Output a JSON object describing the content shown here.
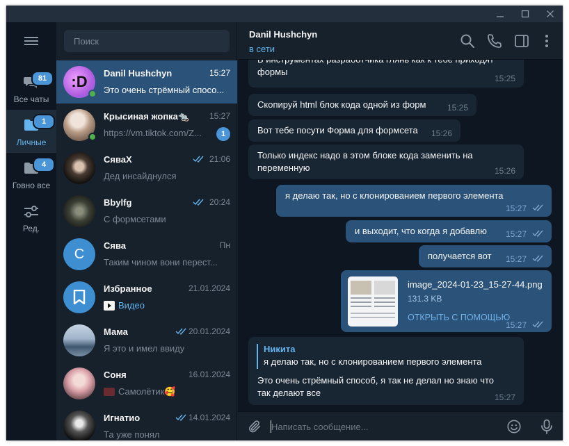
{
  "window": {
    "accent": "#4a94d8",
    "bg_dark": "#0e1621",
    "bg_panel": "#17212b",
    "selected": "#2b5278"
  },
  "folders": [
    {
      "label": "Все чаты",
      "badge": "81",
      "icon": "chat-bubbles-icon"
    },
    {
      "label": "Личные",
      "badge": "1",
      "icon": "folder-icon",
      "active": true
    },
    {
      "label": "Говно все",
      "badge": "4",
      "icon": "folder-icon"
    },
    {
      "label": "Ред.",
      "badge": "",
      "icon": "edit-sliders-icon"
    }
  ],
  "search": {
    "placeholder": "Поиск"
  },
  "chats": [
    {
      "name": "Danil Hushchyn",
      "time": "15:27",
      "preview": "Это очень стрёмный спосо...",
      "avatar": ":D",
      "avatar_color": "#c86ee6",
      "online": true,
      "active": true
    },
    {
      "name": "Крысиная жопка🐀",
      "time": "15:27",
      "preview": "https://vm.tiktok.com/Z...",
      "avatar": "",
      "avatar_color": "#cbb7a3",
      "online": true,
      "unread": "1"
    },
    {
      "name": "СяваХ",
      "time": "21:06",
      "preview": "Дед инсайднулся",
      "avatar": "",
      "avatar_color": "#2a2724",
      "read": true
    },
    {
      "name": "Bbylfg",
      "time": "20:24",
      "preview": "С формсетами",
      "avatar": "",
      "avatar_color": "#3c4236",
      "read": true
    },
    {
      "name": "Сява",
      "time": "Пн",
      "preview": "Таким чином вони перест...",
      "avatar": "С",
      "avatar_color": "#3d8fd1"
    },
    {
      "name": "Избранное",
      "time": "21.01.2024",
      "preview": "Видео",
      "avatar": "",
      "avatar_color": "#3d8fd1",
      "saved": true
    },
    {
      "name": "Мама",
      "time": "20.01.2024",
      "preview": "Я это и имел ввиду",
      "avatar": "",
      "avatar_color": "#8fa6bf",
      "read": true
    },
    {
      "name": "Соня",
      "time": "16.01.2024",
      "preview": "Самолётик🥰",
      "avatar": "",
      "avatar_color": "#d9a0a8"
    },
    {
      "name": "Игнатио",
      "time": "14.01.2024",
      "preview": "Та уже понял",
      "avatar": "",
      "avatar_color": "#1c1c1c",
      "read": true
    }
  ],
  "conversation": {
    "peer_name": "Danil Hushchyn",
    "peer_status": "в сети",
    "messages": [
      {
        "dir": "in",
        "lines": [
          "В инструментах разработчика глянь как к тебе приходят",
          "формы"
        ],
        "time": "15:25"
      },
      {
        "dir": "in",
        "lines": [
          "Скопируй html блок кода одной из форм"
        ],
        "time": "15:25"
      },
      {
        "dir": "in",
        "lines": [
          "Вот тебе посути Форма для формсета"
        ],
        "time": "15:26"
      },
      {
        "dir": "in",
        "lines": [
          "Только индекс надо в этом блоке кода заменить на",
          "переменную"
        ],
        "time": "15:26"
      },
      {
        "dir": "out",
        "lines": [
          "я делаю так, но с клонированием первого элемента"
        ],
        "time": "15:27"
      },
      {
        "dir": "out",
        "lines": [
          "и выходит, что когда я добавлю"
        ],
        "time": "15:27"
      },
      {
        "dir": "out",
        "lines": [
          "получается вот"
        ],
        "time": "15:27"
      },
      {
        "dir": "out",
        "file": {
          "name": "image_2024-01-23_15-27-44.png",
          "size": "131.3 KB",
          "action": "ОТКРЫТЬ С ПОМОЩЬЮ"
        },
        "time": "15:27"
      },
      {
        "dir": "in",
        "reply": {
          "author": "Никита",
          "text": "я делаю так, но с клонированием первого элемента"
        },
        "lines": [
          "Это очень стрёмный способ,  я так не делал но знаю что",
          "так делают все"
        ],
        "time": "15:27"
      }
    ]
  },
  "composer": {
    "placeholder": "Написать сообщение..."
  }
}
